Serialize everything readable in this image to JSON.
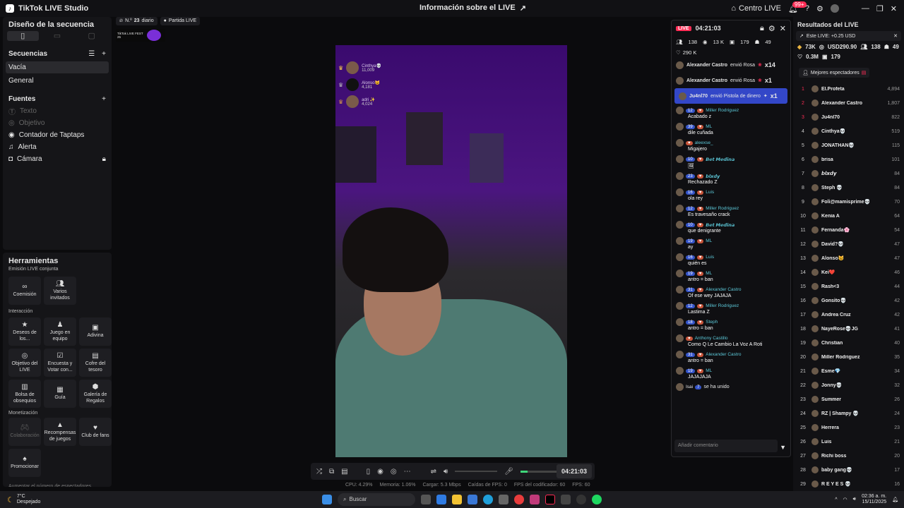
{
  "titlebar": {
    "app_name": "TikTok LIVE Studio",
    "center_title": "Información sobre el LIVE",
    "centro_live": "Centro LIVE",
    "notif_badge": "99+"
  },
  "left": {
    "sequence_design": "Diseño de la secuencia",
    "sequences_title": "Secuencias",
    "sequences": [
      "Vacía",
      "General"
    ],
    "sources_title": "Fuentes",
    "sources": [
      {
        "label": "Texto",
        "dim": true
      },
      {
        "label": "Objetivo",
        "dim": true
      },
      {
        "label": "Contador de Taptaps",
        "dim": false
      },
      {
        "label": "Alerta",
        "dim": false
      },
      {
        "label": "Cámara",
        "dim": false
      }
    ],
    "tools_title": "Herramientas",
    "joint_title": "Emisión LIVE conjunta",
    "joint_tools": [
      "Coemisión",
      "Varios invitados"
    ],
    "interaction_title": "Interacción",
    "interaction_tools": [
      "Deseos de los...",
      "Juego en equipo",
      "Adivina",
      "Objetivo del LIVE",
      "Encuesta y Votar con...",
      "Cofre del tesoro",
      "Bolsa de obsequios",
      "Guía",
      "Galería de Regalos"
    ],
    "monetization_title": "Monetización",
    "monetization_tools": [
      "Colaboración",
      "Recompensas de juegos",
      "Club de fans",
      "Promocionar"
    ],
    "bottom_text": "Aumentar el número de espectadores"
  },
  "top_badges": {
    "rank_prefix": "N.º",
    "rank_num": "23",
    "rank_suffix": "diario",
    "match": "Partida LIVE",
    "fest": "TikTok LIVE FEST 25"
  },
  "top_viewers": [
    {
      "name": "Cinthya💀",
      "points": "11,009"
    },
    {
      "name": "Alonso😺",
      "points": "4,181"
    },
    {
      "name": "adri ✨",
      "points": "4,024"
    }
  ],
  "controls": {
    "timer": "04:21:03"
  },
  "stats": [
    "CPU: 4.29%",
    "Memoria: 1.06%",
    "Cargar: 5.3 Mbps",
    "Caídas de FPS: 0",
    "FPS del codificador: 60",
    "FPS: 60"
  ],
  "chat": {
    "live": "LIVE",
    "timer": "04:21:03",
    "viewers": "138",
    "likes_k": "13 K",
    "gifters": "179",
    "members": "49",
    "total_likes": "290 K",
    "gifts": [
      {
        "user": "Alexander Castro",
        "text": "envió Rosa",
        "count": "x14"
      },
      {
        "user": "Alexander Castro",
        "text": "envió Rosa",
        "count": "x1"
      },
      {
        "user": "Ju4nl70",
        "text": "envió Pistola de dinero",
        "count": "x1"
      }
    ],
    "messages": [
      {
        "lvl": "12",
        "user": "Miller Rodriguez",
        "text": "Acabado z"
      },
      {
        "lvl": "39",
        "user": "ML",
        "text": "dile cuñada"
      },
      {
        "lvl": "",
        "user": "aleexse_",
        "text": "Migajero"
      },
      {
        "lvl": "10",
        "user": "𝘽𝙚𝙩 𝙈𝙚𝙙𝙞𝙣𝙖",
        "text": "🖼"
      },
      {
        "lvl": "23",
        "user": "𝙗𝙡𝙭𝙙𝙮",
        "text": "Rechazado Z"
      },
      {
        "lvl": "16",
        "user": "Luis",
        "text": "ola rey"
      },
      {
        "lvl": "12",
        "user": "Miller Rodriguez",
        "text": "Es travesaño crack"
      },
      {
        "lvl": "10",
        "user": "𝘽𝙚𝙩 𝙈𝙚𝙙𝙞𝙣𝙖",
        "text": "que denigrante"
      },
      {
        "lvl": "19",
        "user": "ML",
        "text": "ay"
      },
      {
        "lvl": "16",
        "user": "Luis",
        "text": "quién es"
      },
      {
        "lvl": "19",
        "user": "ML",
        "text": "antro = ban"
      },
      {
        "lvl": "31",
        "user": "Alexander Castro",
        "text": "Of ese wey JAJAJA"
      },
      {
        "lvl": "12",
        "user": "Miller Rodriguez",
        "text": "Lastima Z"
      },
      {
        "lvl": "18",
        "user": "Steph",
        "text": "antro = ban"
      },
      {
        "lvl": "",
        "user": "Anthony Castillo",
        "text": "Como Q Le Cambio La Voz A Roti"
      },
      {
        "lvl": "31",
        "user": "Alexander Castro",
        "text": "antro = ban"
      },
      {
        "lvl": "19",
        "user": "ML",
        "text": "JAJAJAJA"
      }
    ],
    "joined": {
      "user": "Isai",
      "lvl": "7",
      "text": "se ha unido"
    },
    "input_placeholder": "Añadir comentario"
  },
  "right": {
    "title": "Resultados del LIVE",
    "this_live": "Este LIVE: +0.25 USD",
    "m1": "73K",
    "m2": "USD290.90",
    "m3": "138",
    "m4": "49",
    "m5": "0.3M",
    "m6": "179",
    "best_viewers": "Mejores espectadores",
    "leaderboard": [
      {
        "rank": "1",
        "name": "El.Profeta",
        "pts": "4,894"
      },
      {
        "rank": "2",
        "name": "Alexander Castro",
        "pts": "1,807"
      },
      {
        "rank": "3",
        "name": "Ju4nl70",
        "pts": "822"
      },
      {
        "rank": "4",
        "name": "Cinthya💀",
        "pts": "519"
      },
      {
        "rank": "5",
        "name": "JONATHAN💀",
        "pts": "115"
      },
      {
        "rank": "6",
        "name": "brisa",
        "pts": "101"
      },
      {
        "rank": "7",
        "name": "𝙗𝙡𝙭𝙙𝙮",
        "pts": "84"
      },
      {
        "rank": "8",
        "name": "Steph 💀",
        "pts": "84"
      },
      {
        "rank": "9",
        "name": "Foli@mamisprime💀",
        "pts": "70"
      },
      {
        "rank": "10",
        "name": "Kenia A",
        "pts": "64"
      },
      {
        "rank": "11",
        "name": "Fernanda🌸",
        "pts": "54"
      },
      {
        "rank": "12",
        "name": "David?💀",
        "pts": "47"
      },
      {
        "rank": "13",
        "name": "Alonso😺",
        "pts": "47"
      },
      {
        "rank": "14",
        "name": "Kei❤️",
        "pts": "46"
      },
      {
        "rank": "15",
        "name": "Rash<3",
        "pts": "44"
      },
      {
        "rank": "16",
        "name": "Gonsito💀",
        "pts": "42"
      },
      {
        "rank": "17",
        "name": "Andrea Cruz",
        "pts": "42"
      },
      {
        "rank": "18",
        "name": "NayeRose💀JG",
        "pts": "41"
      },
      {
        "rank": "19",
        "name": "Christian",
        "pts": "40"
      },
      {
        "rank": "20",
        "name": "Miller Rodriguez",
        "pts": "35"
      },
      {
        "rank": "21",
        "name": "Esme💎",
        "pts": "34"
      },
      {
        "rank": "22",
        "name": "Jonny💀",
        "pts": "32"
      },
      {
        "rank": "23",
        "name": "Summer",
        "pts": "26"
      },
      {
        "rank": "24",
        "name": "RZ | Shampy 💀",
        "pts": "24"
      },
      {
        "rank": "25",
        "name": "Herrera",
        "pts": "23"
      },
      {
        "rank": "26",
        "name": "Luis",
        "pts": "21"
      },
      {
        "rank": "27",
        "name": "Richi boss",
        "pts": "20"
      },
      {
        "rank": "28",
        "name": "baby gang💀",
        "pts": "17"
      },
      {
        "rank": "29",
        "name": "R E Y E S 💀",
        "pts": "16"
      }
    ]
  },
  "taskbar": {
    "temp": "7°C",
    "weather": "Despejado",
    "search": "Buscar",
    "time": "02:36 a. m.",
    "date": "15/11/2025"
  }
}
